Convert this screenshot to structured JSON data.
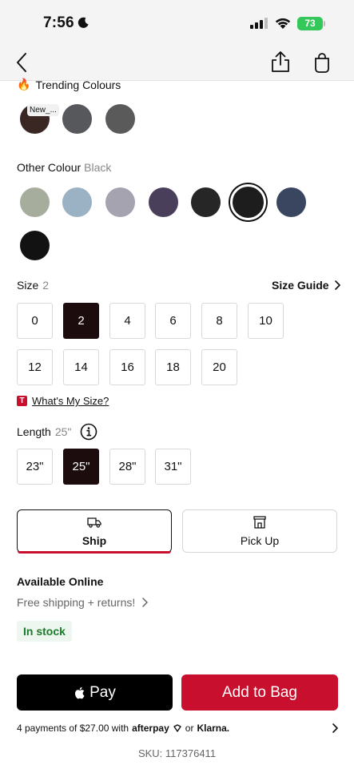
{
  "status_bar": {
    "time": "7:56",
    "battery": "73"
  },
  "trending": {
    "title": "Trending Colours",
    "new_badge": "New_...",
    "swatches": [
      {
        "name": "dark-brown",
        "color": "#3a2622"
      },
      {
        "name": "charcoal-1",
        "color": "#57585c"
      },
      {
        "name": "charcoal-2",
        "color": "#5a5a5a"
      }
    ]
  },
  "other_colour": {
    "label": "Other Colour",
    "selected": "Black",
    "swatches": [
      {
        "name": "sage",
        "color": "#a7ad9c"
      },
      {
        "name": "light-blue",
        "color": "#9bb2c4"
      },
      {
        "name": "lavender-grey",
        "color": "#a5a3b0"
      },
      {
        "name": "purple",
        "color": "#4a3f5a"
      },
      {
        "name": "black-wash",
        "color": "#262626"
      },
      {
        "name": "black",
        "color": "#1d1d1d"
      },
      {
        "name": "navy",
        "color": "#3a4560"
      },
      {
        "name": "black-2",
        "color": "#121212"
      }
    ]
  },
  "size": {
    "label": "Size",
    "selected": "2",
    "guide_label": "Size Guide",
    "options": [
      "0",
      "2",
      "4",
      "6",
      "8",
      "10",
      "12",
      "14",
      "16",
      "18",
      "20"
    ],
    "whats_my_size": "What's My Size?",
    "t_icon": "T"
  },
  "length": {
    "label": "Length",
    "selected": "25\"",
    "options": [
      "23\"",
      "25\"",
      "28\"",
      "31\""
    ]
  },
  "fulfillment": {
    "ship_label": "Ship",
    "pickup_label": "Pick Up"
  },
  "availability": {
    "title": "Available Online",
    "free_shipping": "Free shipping + returns!",
    "stock": "In stock"
  },
  "actions": {
    "apple_pay": "Pay",
    "add_to_bag": "Add to Bag"
  },
  "payments": {
    "text": "4 payments of $27.00 with",
    "afterpay": "afterpay",
    "or": "or",
    "klarna": "Klarna."
  },
  "sku": "SKU: 117376411",
  "colors": {
    "accent": "#c8102e",
    "selected_chip": "#1c0c0e",
    "stock_green": "#1b7a2a"
  }
}
